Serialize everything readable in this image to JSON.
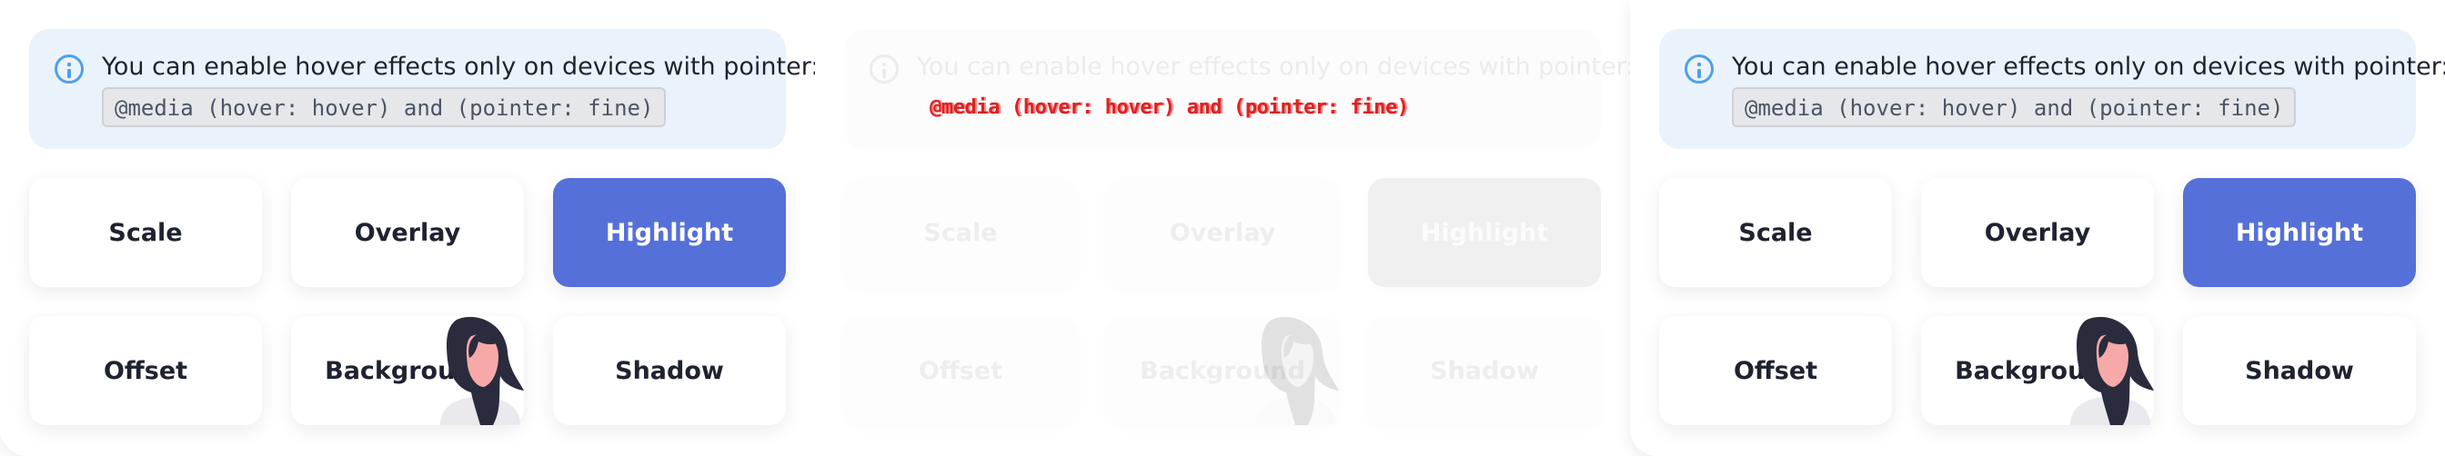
{
  "panels": [
    {
      "info_text": "You can enable hover effects only on devices with pointer:",
      "code": "@media (hover: hover) and (pointer: fine)",
      "tiles": [
        "Scale",
        "Overlay",
        "Highlight",
        "Offset",
        "Background",
        "Shadow"
      ]
    },
    {
      "info_text": "You can enable hover effects only on devices with pointer:",
      "code": "@media (hover: hover) and (pointer: fine)",
      "tiles": [
        "Scale",
        "Overlay",
        "Highlight",
        "Offset",
        "Background",
        "Shadow"
      ]
    },
    {
      "info_text": "You can enable hover effects only on devices with pointer:",
      "code": "@media (hover: hover) and (pointer: fine)",
      "tiles": [
        "Scale",
        "Overlay",
        "Highlight",
        "Offset",
        "Background",
        "Shadow"
      ]
    }
  ],
  "colors": {
    "info_bg": "#eaf3fc",
    "info_icon": "#4fa0e8",
    "highlight": "#5570d8",
    "text": "#1f2330",
    "hair": "#2a2b3c",
    "skin": "#f7a9a8"
  },
  "icons": [
    "info-icon",
    "person-figure"
  ]
}
